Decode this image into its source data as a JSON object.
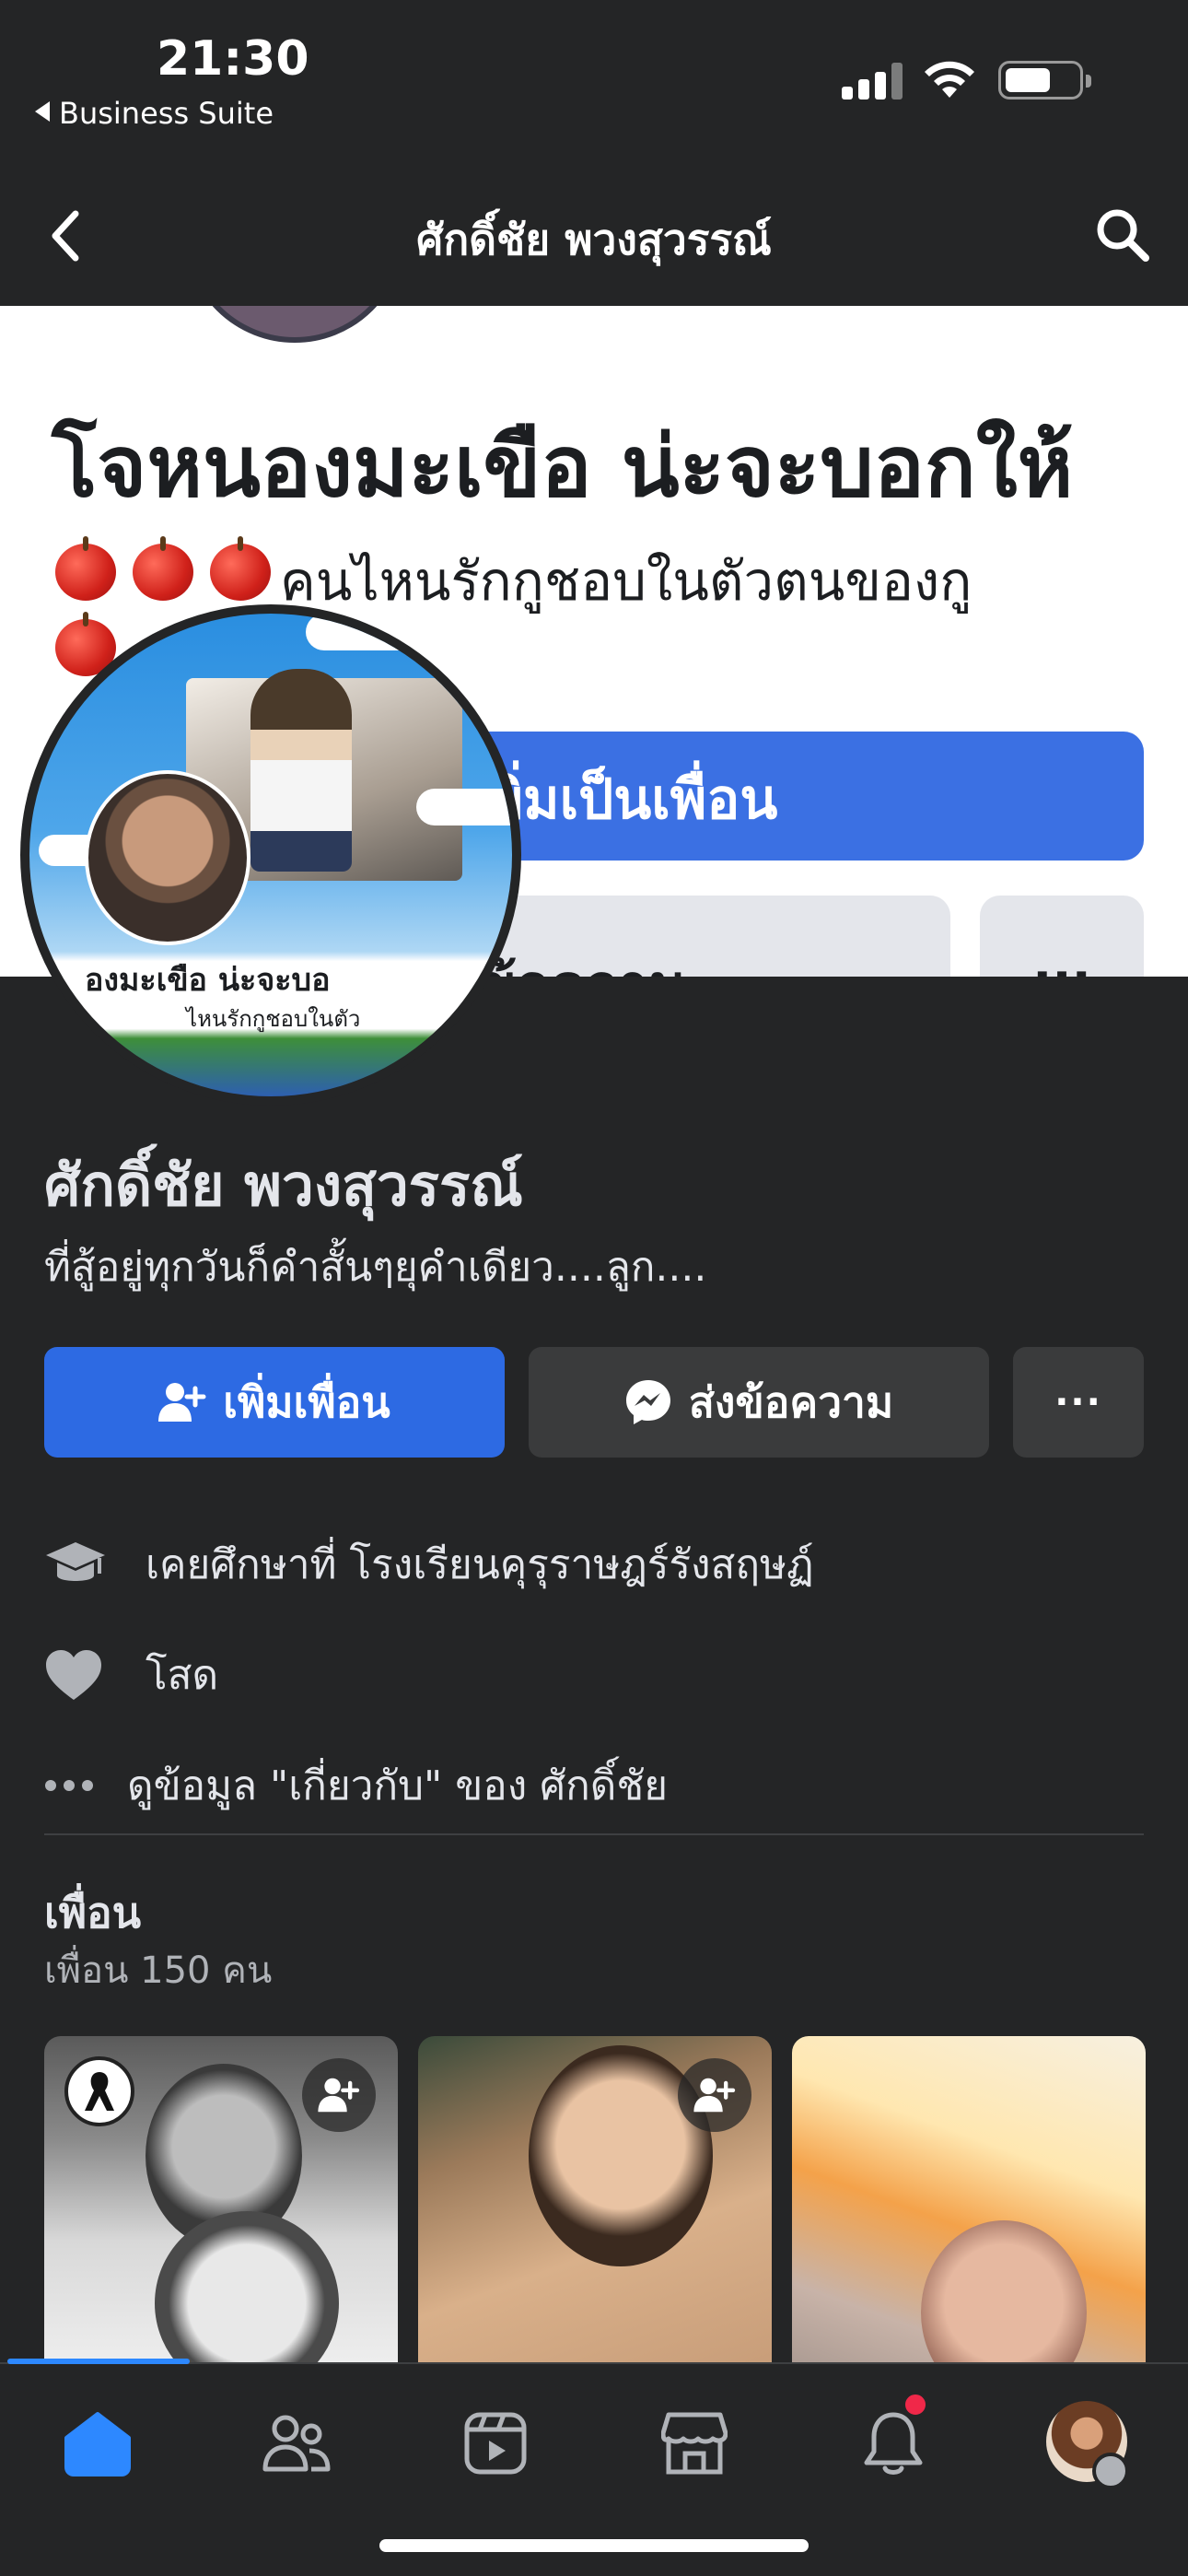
{
  "status_bar": {
    "time": "21:30",
    "back_app": "Business Suite"
  },
  "header": {
    "title": "ศักดิ์ชัย พวงสุวรรณ์"
  },
  "cover": {
    "name": "โจหนองมะเขือ น่ะจะบอกให้",
    "bio": "คนไหนรักกูชอบในตัวตนของกู",
    "add_friend_label": "เพิ่มเป็นเพื่อน",
    "message_label": "ข้อความ",
    "more_label": "···"
  },
  "avatar_image": {
    "name_text": "องมะเขือ น่ะจะบอ",
    "sub_text": "ไหนรักกูชอบในตัว"
  },
  "profile": {
    "name": "ศักดิ์ชัย พวงสุวรรณ์",
    "bio": "ที่สู้อยู่ทุกวันก็คำสั้นๆยุคำเดียว....ลูก....",
    "add_friend_label": "เพิ่มเพื่อน",
    "message_label": "ส่งข้อความ",
    "more_label": "···"
  },
  "details": {
    "education": "เคยศึกษาที่ โรงเรียนคุรุราษฎร์รังสฤษฏ์",
    "relationship": "โสด",
    "about_link": "ดูข้อมูล \"เกี่ยวกับ\" ของ ศักดิ์ชัย"
  },
  "friends": {
    "title": "เพื่อน",
    "count": "เพื่อน 150 คน"
  },
  "tabs": [
    "home-icon",
    "friends-icon",
    "watch-icon",
    "marketplace-icon",
    "notifications-icon",
    "profile-menu-icon"
  ],
  "colors": {
    "background": "#242526",
    "primary_button": "#2d6ae3",
    "secondary_button": "#3a3b3c",
    "accent": "#2d88ff",
    "notification_dot": "#f02849"
  }
}
